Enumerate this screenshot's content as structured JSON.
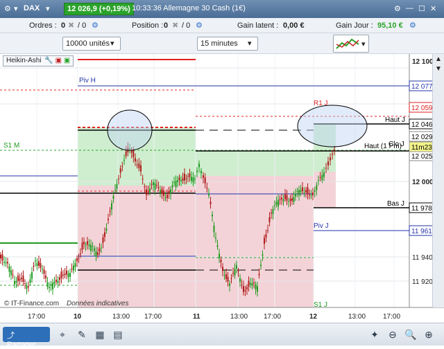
{
  "titlebar": {
    "instrument": "DAX",
    "price": "12 026,9 (+0,19%)",
    "time_name": "10:33:36 Allemagne 30 Cash (1€)"
  },
  "toolbar1": {
    "orders_label": "Ordres :",
    "orders_a": "0",
    "orders_b": "/ 0",
    "position_label": "Position :",
    "position_a": "0",
    "position_b": "/ 0",
    "latent_label": "Gain latent :",
    "latent_value": "0,00 €",
    "gain_day_label": "Gain Jour :",
    "gain_day_value": "95,10 €"
  },
  "toolbar2": {
    "units": "10000 unités",
    "period": "15 minutes"
  },
  "indicator": {
    "name": "Heikin-Ashi"
  },
  "price_axis": {
    "ticks": [
      "12 100",
      "12 000",
      "11 960",
      "11 940",
      "11 920"
    ],
    "boxes": [
      "12 077,8",
      "12 059,9",
      "12 046,2",
      "12 029,0",
      "12 025,0",
      "11m23s",
      "11 978,7",
      "11 961,3"
    ]
  },
  "time_axis": {
    "labels": [
      "17:00",
      "10",
      "13:00",
      "17:00",
      "11",
      "13:00",
      "17:00",
      "12",
      "13:00",
      "17:00"
    ]
  },
  "annotations": {
    "piv_h": "Piv H",
    "s1_m": "S1 M",
    "r1_j": "R1 J",
    "haut_j": "Haut J",
    "haut_1pm": "Haut (1 Pm)",
    "clo_j": "Clo J",
    "bas_j": "Bas J",
    "piv_j": "Piv J",
    "s1_j": "S1 J",
    "copyright": "© IT-Finance.com",
    "disclaimer": "Données indicatives"
  },
  "bottom": {
    "share_label": "Partager"
  },
  "colors": {
    "up": "#1f9a1f",
    "down": "#b01818",
    "zone_green": "#cfeecf",
    "zone_red": "#f3d3d8"
  },
  "chart_data": {
    "type": "line",
    "title": "",
    "ylim": [
      11905,
      12110
    ],
    "x": [
      "17:00",
      "10",
      "13:00",
      "17:00",
      "11",
      "13:00",
      "17:00",
      "12",
      "13:00",
      "17:00"
    ],
    "series": [
      {
        "values": [
          11955,
          11935,
          11920,
          12015,
          11990,
          11995,
          11915,
          11990,
          12040,
          12030
        ]
      }
    ]
  }
}
